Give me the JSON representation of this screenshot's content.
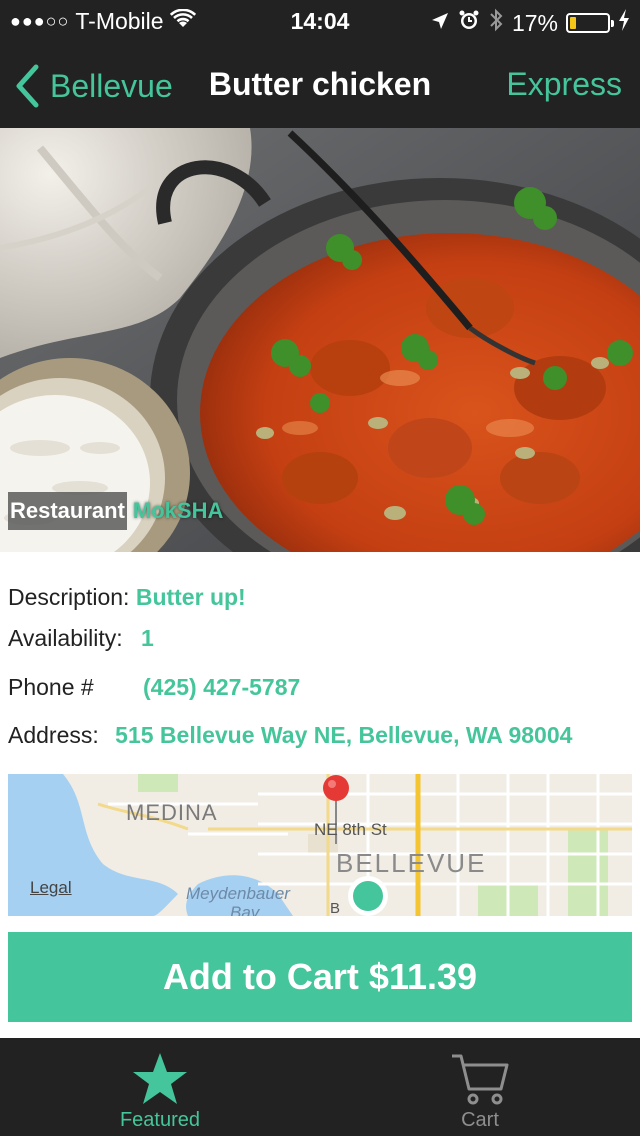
{
  "status_bar": {
    "signal_dots": "●●●○○",
    "carrier": "T-Mobile",
    "time": "14:04",
    "battery": "17%",
    "battery_level": 0.17
  },
  "nav": {
    "back_label": "Bellevue",
    "title": "Butter chicken",
    "right_label": "Express"
  },
  "hero": {
    "restaurant_label": "Restaurant",
    "restaurant_name": "MokSHA"
  },
  "details": {
    "description_label": "Description:",
    "description_value": "Butter up!",
    "availability_label": "Availability:",
    "availability_value": "1",
    "phone_label": "Phone #",
    "phone_value": "(425) 427-5787",
    "address_label": "Address:",
    "address_value": "515 Bellevue Way NE, Bellevue, WA 98004"
  },
  "map": {
    "medina": "MEDINA",
    "street": "NE 8th St",
    "city": "BELLEVUE",
    "bay": "Meydenbauer",
    "bay2": "Bay",
    "legal": "Legal",
    "b_road": "B"
  },
  "cart_button": {
    "label": "Add to Cart $11.39"
  },
  "tabs": [
    {
      "label": "Featured",
      "icon": "star-icon",
      "active": true
    },
    {
      "label": "Cart",
      "icon": "cart-icon",
      "active": false
    }
  ],
  "colors": {
    "accent": "#45c59b",
    "bar_bg": "#222222",
    "inactive": "#8e8e8e"
  }
}
